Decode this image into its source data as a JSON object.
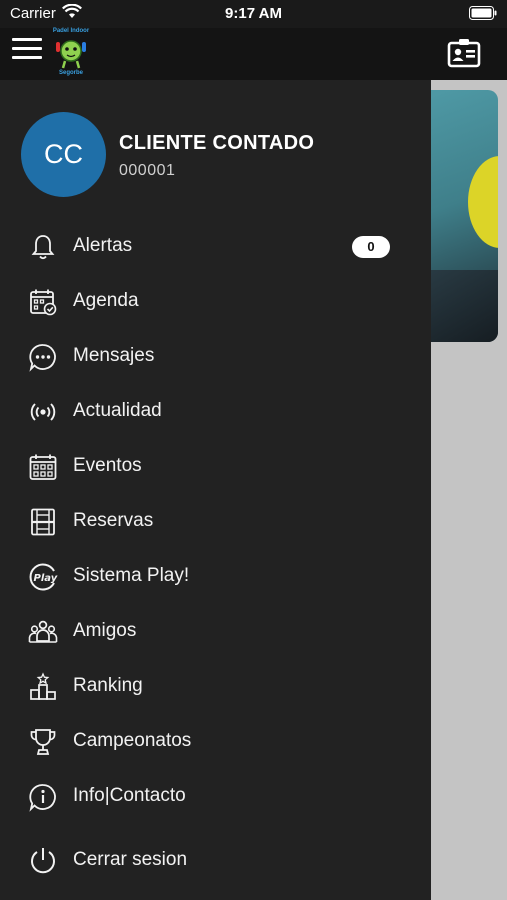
{
  "status_bar": {
    "carrier": "Carrier",
    "time": "9:17 AM"
  },
  "header": {
    "logo_top": "Padel Indoor",
    "logo_bottom": "Segorbe"
  },
  "profile": {
    "initials": "CC",
    "name": "CLIENTE CONTADO",
    "code": "000001"
  },
  "menu": {
    "items": [
      {
        "label": "Alertas",
        "icon": "bell-icon",
        "badge": "0"
      },
      {
        "label": "Agenda",
        "icon": "calendar-check-icon"
      },
      {
        "label": "Mensajes",
        "icon": "chat-bubble-icon"
      },
      {
        "label": "Actualidad",
        "icon": "broadcast-icon"
      },
      {
        "label": "Eventos",
        "icon": "calendar-grid-icon"
      },
      {
        "label": "Reservas",
        "icon": "court-icon"
      },
      {
        "label": "Sistema Play!",
        "icon": "play-badge-icon"
      },
      {
        "label": "Amigos",
        "icon": "group-icon"
      },
      {
        "label": "Ranking",
        "icon": "podium-icon"
      },
      {
        "label": "Campeonatos",
        "icon": "trophy-icon"
      },
      {
        "label": "Info|Contacto",
        "icon": "info-icon"
      },
      {
        "label": "Cerrar sesion",
        "icon": "power-icon"
      }
    ]
  },
  "colors": {
    "drawer_bg": "#222222",
    "avatar_bg": "#1f6fa8",
    "header_bg": "#141414",
    "logo_text": "#3aa0e0"
  }
}
